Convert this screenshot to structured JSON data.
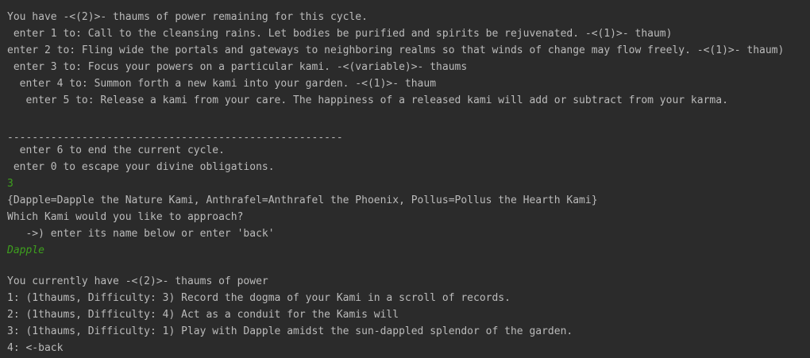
{
  "console": {
    "top_rule": "-------------------------------------------------------------------------------------------------------------------",
    "power_remaining": "You have -<(2)>- thaums of power remaining for this cycle.",
    "options": [
      " enter 1 to: Call to the cleansing rains. Let bodies be purified and spirits be rejuvenated. -<(1)>- thaum)",
      "enter 2 to: Fling wide the portals and gateways to neighboring realms so that winds of change may flow freely. -<(1)>- thaum)",
      " enter 3 to: Focus your powers on a particular kami. -<(variable)>- thaums",
      "  enter 4 to: Summon forth a new kami into your garden. -<(1)>- thaum",
      "   enter 5 to: Release a kami from your care. The happiness of a released kami will add or subtract from your karma."
    ],
    "mid_rule": "------------------------------------------------------",
    "end_cycle": "  enter 6 to end the current cycle.",
    "escape": " enter 0 to escape your divine obligations.",
    "user_input_1": "3",
    "kami_map": "{Dapple=Dapple the Nature Kami, Anthrafel=Anthrafel the Phoenix, Pollus=Pollus the Hearth Kami}",
    "approach_prompt": "Which Kami would you like to approach?",
    "approach_hint": "   ->) enter its name below or enter 'back'",
    "user_input_2": "Dapple",
    "current_power": "You currently have -<(2)>- thaums of power",
    "actions": [
      "1: (1thaums, Difficulty: 3) Record the dogma of your Kami in a scroll of records.",
      "2: (1thaums, Difficulty: 4) Act as a conduit for the Kamis will",
      "3: (1thaums, Difficulty: 1) Play with Dapple amidst the sun-dappled splendor of the garden.",
      "4: <-back"
    ]
  }
}
